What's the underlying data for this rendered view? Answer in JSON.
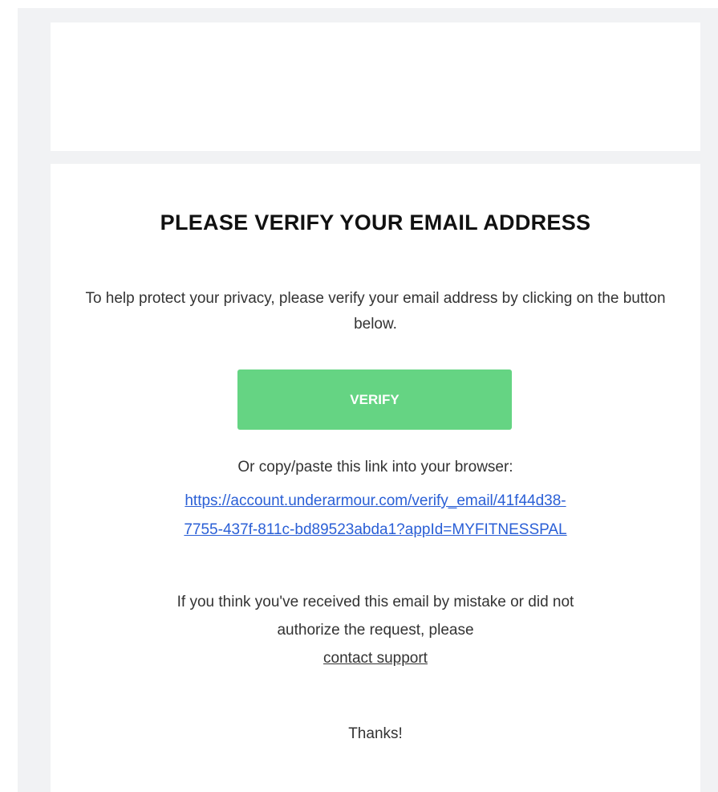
{
  "email": {
    "title": "PLEASE VERIFY YOUR EMAIL ADDRESS",
    "intro": "To help protect your privacy, please verify your email address by clicking on the button below.",
    "verify_button_label": "VERIFY",
    "copy_paste_text": "Or copy/paste this link into your browser:",
    "verify_link_line1": "https://account.underarmour.com/verify_email/41f44d38-",
    "verify_link_line2": "7755-437f-811c-bd89523abda1?appId=MYFITNESSPAL",
    "mistake_line1": "If you think you've received this email by mistake or did not",
    "mistake_line2": "authorize the request, please",
    "support_link_label": "contact support",
    "thanks": "Thanks!"
  },
  "colors": {
    "page_background": "#f1f2f4",
    "card_background": "#ffffff",
    "verify_button": "#65d483",
    "link": "#2a5fd6",
    "text": "#333333"
  }
}
